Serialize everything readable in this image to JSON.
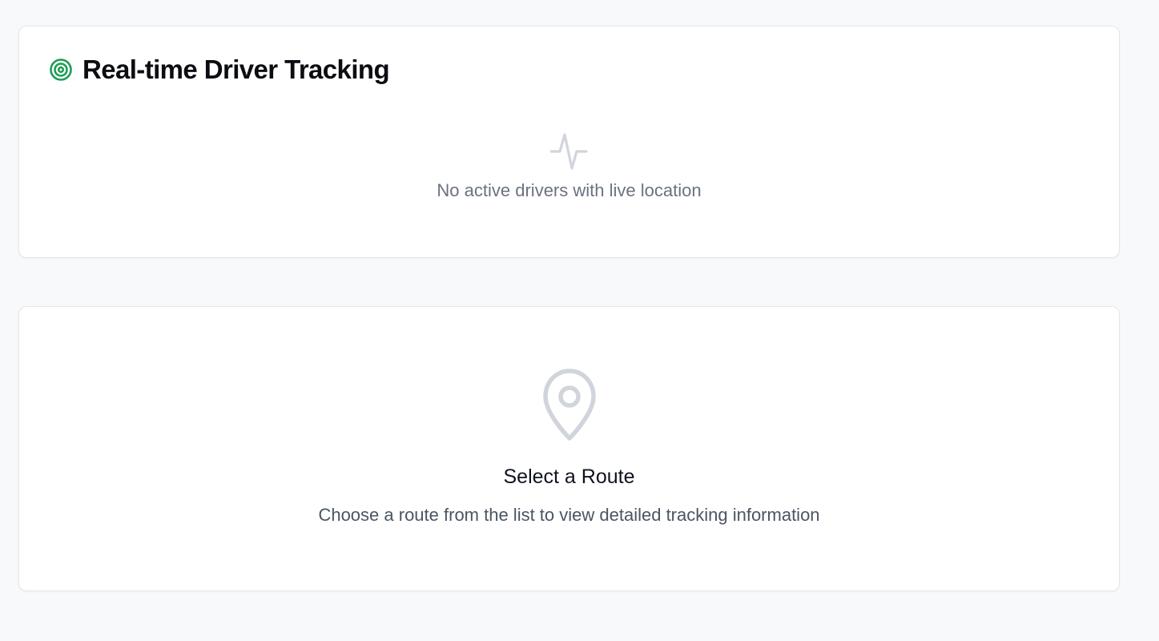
{
  "tracking": {
    "title": "Real-time Driver Tracking",
    "title_icon": "target-icon",
    "accent_color": "#1f9d55",
    "empty_icon": "activity-icon",
    "empty_text": "No active drivers with live location"
  },
  "route_panel": {
    "icon": "map-pin-icon",
    "title": "Select a Route",
    "description": "Choose a route from the list to view detailed tracking information"
  },
  "colors": {
    "background": "#f8f9fb",
    "card": "#ffffff",
    "muted_icon": "#d1d5db",
    "muted_text": "#6b7280"
  }
}
